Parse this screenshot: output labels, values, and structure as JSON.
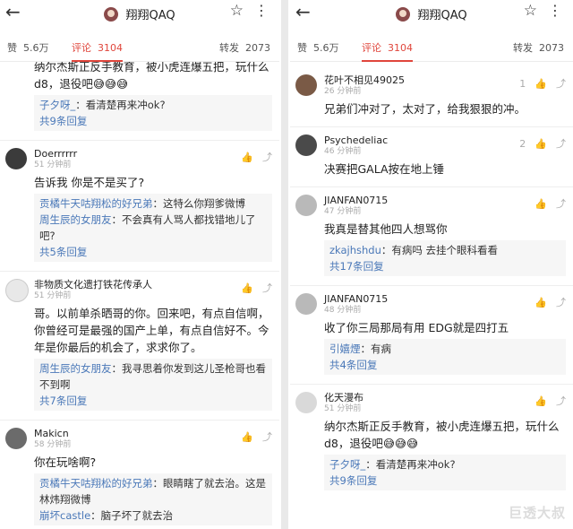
{
  "left_panel": {
    "title": "翔翔QAQ",
    "stats": {
      "like_label": "赞",
      "like_count": "5.6万",
      "comment_label": "评论",
      "comment_count": "3104",
      "repost_label": "转发",
      "repost_count": "2073"
    },
    "top_fragment": {
      "text": "纳尔杰斯正反手教育，被小虎连爆五把，玩什么d8，退役吧😅😅😅",
      "replies": [
        {
          "user": "子夕呀_",
          "text": "：看清楚再来冲ok?"
        }
      ],
      "more": "共9条回复"
    },
    "comments": [
      {
        "name": "Doerrrrrr",
        "time": "51 分钟前",
        "text": "告诉我 你是不是买了?",
        "replies": [
          {
            "user": "贡橘牛天咕翔松的好兄弟",
            "text": "：这特么你翔爹微博"
          },
          {
            "user": "周生辰的女朋友",
            "text": "：不会真有人骂人都找错地儿了吧?"
          }
        ],
        "more": "共5条回复"
      },
      {
        "name": "非物质文化遗打铁花传承人",
        "time": "51 分钟前",
        "text": "哥。以前单杀晒哥的你。回来吧，有点自信啊，你曾经可是最强的国产上单，有点自信好不。今年是你最后的机会了，求求你了。",
        "replies": [
          {
            "user": "周生辰的女朋友",
            "text": "：我寻思着你发到这儿圣枪哥也看不到啊"
          }
        ],
        "more": "共7条回复"
      },
      {
        "name": "Makicn",
        "time": "58 分钟前",
        "text": "你在玩啥啊?",
        "replies": [
          {
            "user": "贡橘牛天咕翔松的好兄弟",
            "text": "：眼睛瞎了就去治。这是林炜翔微博"
          },
          {
            "user": "崩坏castle",
            "text": "：脑子坏了就去治"
          }
        ],
        "more": ""
      }
    ]
  },
  "right_panel": {
    "title": "翔翔QAQ",
    "stats": {
      "like_label": "赞",
      "like_count": "5.6万",
      "comment_label": "评论",
      "comment_count": "3104",
      "repost_label": "转发",
      "repost_count": "2073"
    },
    "comments": [
      {
        "name": "花叶不相见49025",
        "time": "26 分钟前",
        "text": "兄弟们冲对了，太对了，给我狠狠的冲。",
        "likes": "1",
        "replies": [],
        "more": ""
      },
      {
        "name": "Psychedeliac",
        "time": "46 分钟前",
        "text": "决赛把GALA按在地上锤",
        "likes": "2",
        "replies": [],
        "more": ""
      },
      {
        "name": "JIANFAN0715",
        "time": "47 分钟前",
        "text": "我真是替其他四人想骂你",
        "likes": "",
        "replies": [
          {
            "user": "zkajhshdu",
            "text": "：有病吗 去挂个眼科看看"
          }
        ],
        "more": "共17条回复"
      },
      {
        "name": "JIANFAN0715",
        "time": "48 分钟前",
        "text": "收了你三局那局有用 EDG就是四打五",
        "likes": "",
        "replies": [
          {
            "user": "引嬉煙",
            "text": "：有病"
          }
        ],
        "more": "共4条回复"
      },
      {
        "name": "化天漫布",
        "time": "51 分钟前",
        "text": "纳尔杰斯正反手教育，被小虎连爆五把，玩什么d8，退役吧😅😅😅",
        "likes": "",
        "replies": [
          {
            "user": "子夕呀_",
            "text": "：看清楚再来冲ok?"
          }
        ],
        "more": "共9条回复"
      }
    ],
    "watermark": "巨透大叔"
  }
}
